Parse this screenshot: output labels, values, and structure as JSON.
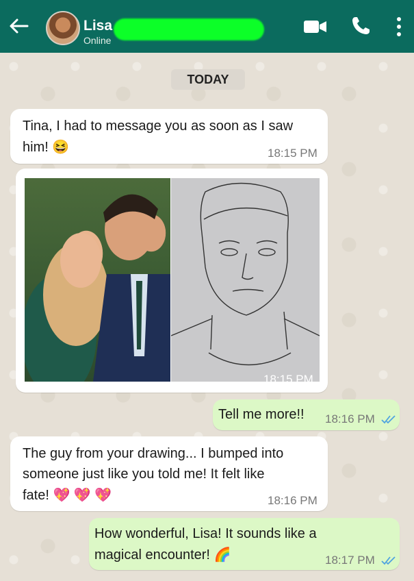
{
  "header": {
    "contact_name": "Lisa",
    "contact_status": "Online",
    "icons": [
      "back-arrow-icon",
      "video-call-icon",
      "phone-icon",
      "more-menu-icon"
    ]
  },
  "date_chip": "TODAY",
  "messages": [
    {
      "direction": "incoming",
      "lines": [
        "Tina, I had to message you as soon as I saw",
        "him! 😆"
      ],
      "time": "18:15 PM"
    },
    {
      "direction": "incoming",
      "type": "image",
      "time": "18:15 PM"
    },
    {
      "direction": "outgoing",
      "lines": [
        "Tell me more!!"
      ],
      "time": "18:16 PM",
      "status": "read"
    },
    {
      "direction": "incoming",
      "lines": [
        "The guy from your drawing... I bumped into",
        "someone just like you told me! It felt like",
        "fate! 💖 💖 💖"
      ],
      "time": "18:16 PM"
    },
    {
      "direction": "outgoing",
      "lines": [
        "How wonderful, Lisa! It sounds like a",
        "magical encounter! 🌈"
      ],
      "time": "18:17 PM",
      "status": "read"
    }
  ],
  "colors": {
    "header_bg": "#0b6b5e",
    "incoming_bubble": "#ffffff",
    "outgoing_bubble": "#dcf8c6",
    "read_ticks": "#4fa3e0"
  }
}
